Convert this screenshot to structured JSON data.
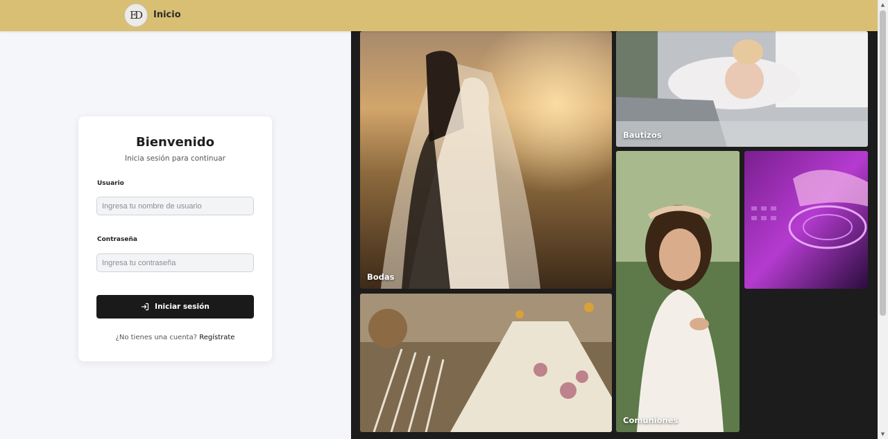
{
  "header": {
    "logo_text": "ED",
    "title": "Inicio"
  },
  "login": {
    "title": "Bienvenido",
    "subtitle": "Inicia sesión para continuar",
    "username_label": "Usuario",
    "username_placeholder": "Ingresa tu nombre de usuario",
    "username_value": "",
    "password_label": "Contraseña",
    "password_placeholder": "Ingresa tu contraseña",
    "password_value": "",
    "submit_label": "Iniciar sesión",
    "no_account_text": "¿No tienes una cuenta?",
    "register_link": "Regístrate"
  },
  "gallery": {
    "tiles": [
      {
        "label": "Bodas"
      },
      {
        "label": "Bautizos"
      },
      {
        "label": ""
      },
      {
        "label": "Comuniones"
      },
      {
        "label": ""
      }
    ]
  },
  "colors": {
    "header_bg": "#d9bf73",
    "button_bg": "#1a1a1a",
    "gallery_bg": "#1c1c1c"
  },
  "icons": {
    "login_button": "login-arrow-icon",
    "scroll_up": "scroll-up-arrow-icon",
    "scroll_down": "scroll-down-arrow-icon"
  }
}
